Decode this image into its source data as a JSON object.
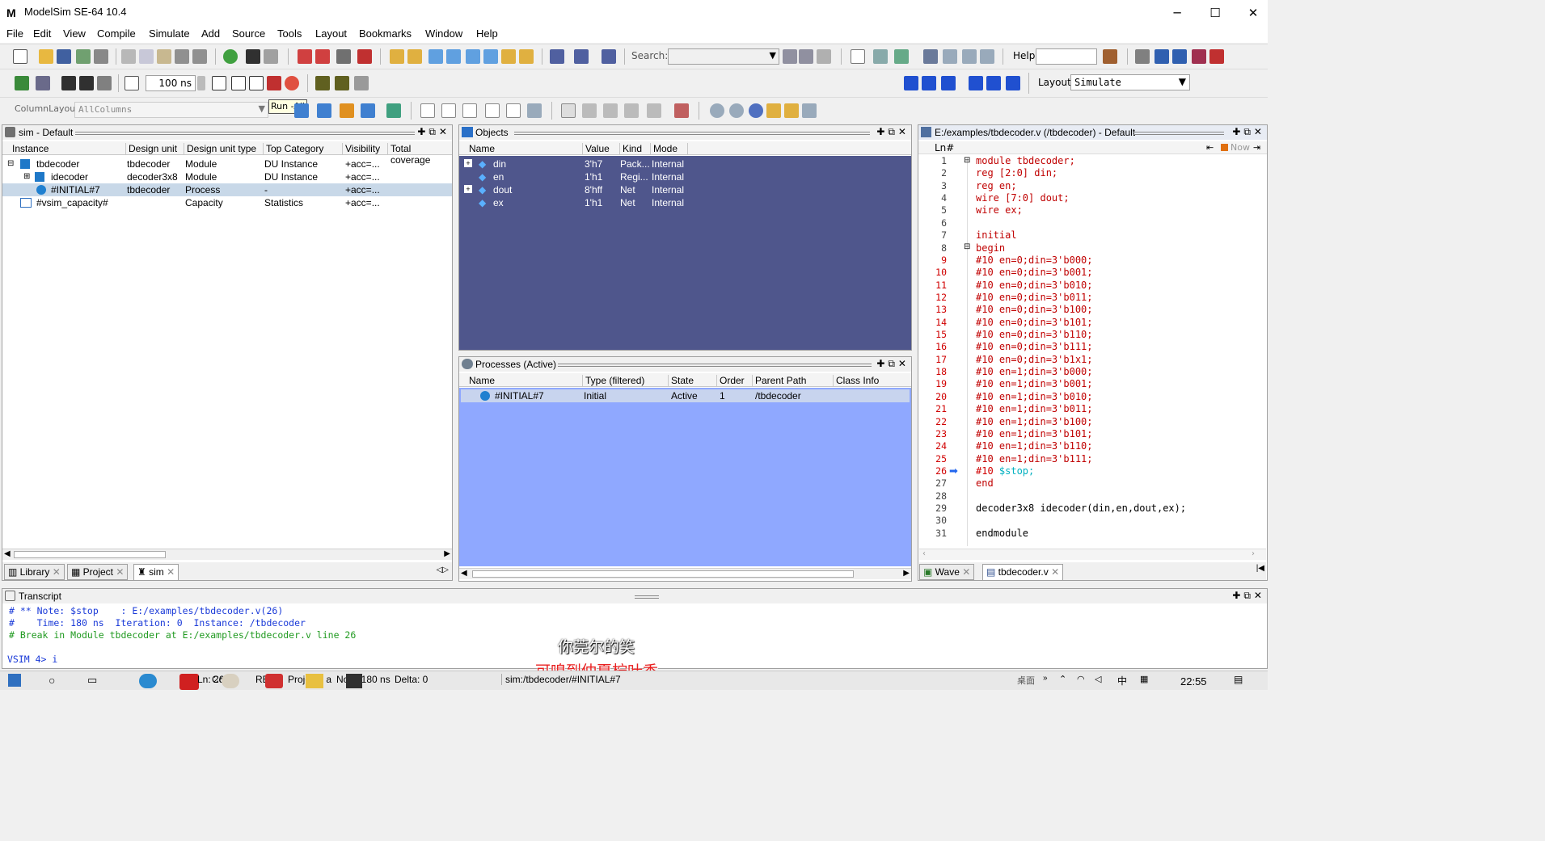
{
  "window": {
    "app_title": "ModelSim SE-64 10.4",
    "logo": "M",
    "min": "─",
    "max": "☐",
    "close": "✕"
  },
  "menu": [
    "File",
    "Edit",
    "View",
    "Compile",
    "Simulate",
    "Add",
    "Source",
    "Tools",
    "Layout",
    "Bookmarks",
    "Window",
    "Help"
  ],
  "toolbar": {
    "search_label": "Search:",
    "help_label": "Help",
    "run_length": "100 ns",
    "layout_label": "Layout",
    "layout_value": "Simulate",
    "column_layout_label": "ColumnLayout",
    "column_layout_value": "AllColumns",
    "tooltip": "Run -All"
  },
  "sim_panel": {
    "title": "sim - Default",
    "columns": [
      "Instance",
      "Design unit",
      "Design unit type",
      "Top Category",
      "Visibility",
      "Total coverage"
    ],
    "rows": [
      {
        "instance": "tbdecoder",
        "unit": "tbdecoder",
        "type": "Module",
        "category": "DU Instance",
        "visibility": "+acc=..."
      },
      {
        "instance": "idecoder",
        "unit": "decoder3x8",
        "type": "Module",
        "category": "DU Instance",
        "visibility": "+acc=..."
      },
      {
        "instance": "#INITIAL#7",
        "unit": "tbdecoder",
        "type": "Process",
        "category": "-",
        "visibility": "+acc=..."
      },
      {
        "instance": "#vsim_capacity#",
        "unit": "",
        "type": "Capacity",
        "category": "Statistics",
        "visibility": "+acc=..."
      }
    ],
    "tabs": [
      "Library",
      "Project",
      "sim"
    ]
  },
  "objects_panel": {
    "title": "Objects",
    "columns": [
      "Name",
      "Value",
      "Kind",
      "Mode"
    ],
    "rows": [
      {
        "name": "din",
        "value": "3'h7",
        "kind": "Pack...",
        "mode": "Internal"
      },
      {
        "name": "en",
        "value": "1'h1",
        "kind": "Regi...",
        "mode": "Internal"
      },
      {
        "name": "dout",
        "value": "8'hff",
        "kind": "Net",
        "mode": "Internal"
      },
      {
        "name": "ex",
        "value": "1'h1",
        "kind": "Net",
        "mode": "Internal"
      }
    ]
  },
  "processes_panel": {
    "title": "Processes (Active)",
    "columns": [
      "Name",
      "Type (filtered)",
      "State",
      "Order",
      "Parent Path",
      "Class Info"
    ],
    "rows": [
      {
        "name": "#INITIAL#7",
        "type": "Initial",
        "state": "Active",
        "order": "1",
        "parent": "/tbdecoder"
      }
    ]
  },
  "source_panel": {
    "title": "E:/examples/tbdecoder.v (/tbdecoder) - Default",
    "ln_header": "Ln#",
    "now_label": "Now",
    "lines": [
      "module tbdecoder;",
      "reg [2:0] din;",
      "reg en;",
      "wire [7:0] dout;",
      "wire ex;",
      "",
      "initial",
      "begin",
      "#10 en=0;din=3'b000;",
      "#10 en=0;din=3'b001;",
      "#10 en=0;din=3'b010;",
      "#10 en=0;din=3'b011;",
      "#10 en=0;din=3'b100;",
      "#10 en=0;din=3'b101;",
      "#10 en=0;din=3'b110;",
      "#10 en=0;din=3'b111;",
      "#10 en=0;din=3'b1x1;",
      "#10 en=1;din=3'b000;",
      "#10 en=1;din=3'b001;",
      "#10 en=1;din=3'b010;",
      "#10 en=1;din=3'b011;",
      "#10 en=1;din=3'b100;",
      "#10 en=1;din=3'b101;",
      "#10 en=1;din=3'b110;",
      "#10 en=1;din=3'b111;",
      "#10 $stop;",
      "end",
      "",
      "decoder3x8 idecoder(din,en,dout,ex);",
      "",
      "endmodule"
    ],
    "tabs": [
      "Wave",
      "tbdecoder.v"
    ]
  },
  "transcript": {
    "title": "Transcript",
    "lines": [
      "# ** Note: $stop    : E:/examples/tbdecoder.v(26)",
      "#    Time: 180 ns  Iteration: 0  Instance: /tbdecoder",
      "# Break in Module tbdecoder at E:/examples/tbdecoder.v line 26"
    ],
    "prompt": "VSIM 4> i"
  },
  "subtitles": {
    "line1": "你莞尔的笑",
    "line2": "可嗅到仲夏柠叶香"
  },
  "statusbar": {
    "ln": "Ln: 26",
    "col": "Col: 0",
    "read": "READ",
    "project": "Project : a",
    "now": "Now: 180 ns",
    "delta": "Delta: 0",
    "path": "sim:/tbdecoder/#INITIAL#7",
    "clock": "22:55",
    "tray_label": "桌面",
    "tray_ime": "中"
  }
}
